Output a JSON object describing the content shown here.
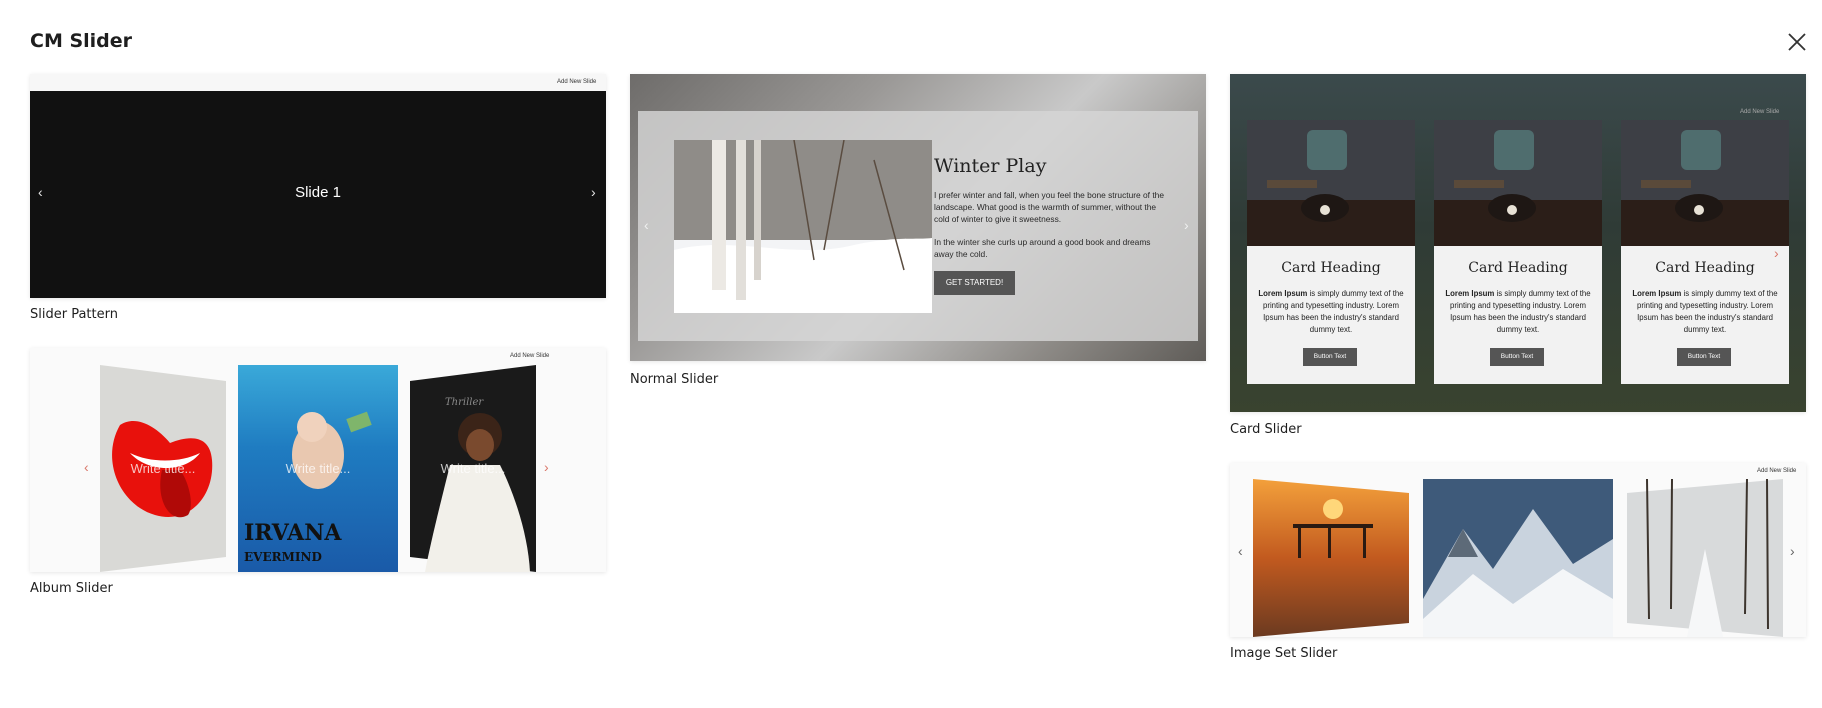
{
  "modal": {
    "title": "CM Slider"
  },
  "add_new_label": "Add New Slide",
  "templates": {
    "slider_pattern": {
      "label": "Slider Pattern",
      "slide_text": "Slide 1"
    },
    "album_slider": {
      "label": "Album Slider",
      "slide_title_placeholder": "Write title..."
    },
    "normal_slider": {
      "label": "Normal Slider",
      "heading": "Winter Play",
      "paragraph1": "I prefer winter and fall, when you feel the bone structure of the landscape. What good is the warmth of summer, without the cold of winter to give it sweetness.",
      "paragraph2": "In the winter she curls up around a good book and dreams away the cold.",
      "button": "GET STARTED!"
    },
    "card_slider": {
      "label": "Card Slider",
      "cards": [
        {
          "heading": "Card Heading",
          "text_bold": "Lorem Ipsum",
          "text": " is simply dummy text of the printing and typesetting industry. Lorem Ipsum has been the industry's standard dummy text.",
          "button": "Button Text"
        },
        {
          "heading": "Card Heading",
          "text_bold": "Lorem Ipsum",
          "text": " is simply dummy text of the printing and typesetting industry. Lorem Ipsum has been the industry's standard dummy text.",
          "button": "Button Text"
        },
        {
          "heading": "Card Heading",
          "text_bold": "Lorem Ipsum",
          "text": " is simply dummy text of the printing and typesetting industry. Lorem Ipsum has been the industry's standard dummy text.",
          "button": "Button Text"
        }
      ]
    },
    "image_set_slider": {
      "label": "Image Set Slider"
    }
  },
  "icons": {
    "close": "close-icon",
    "prev": "chevron-left-icon",
    "next": "chevron-right-icon"
  },
  "colors": {
    "arrow_accent": "#d9776a",
    "arrow_light": "#e6e6e6",
    "arrow_dark": "#666666"
  }
}
